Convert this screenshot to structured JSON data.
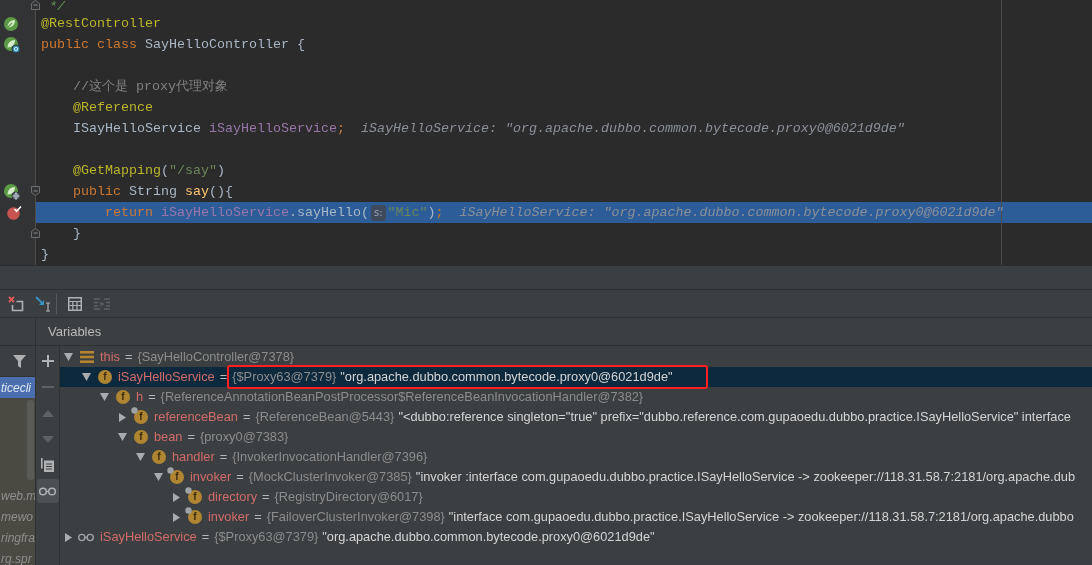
{
  "editor": {
    "lines": [
      {
        "tokens": [
          {
            "text": " */",
            "kind": "doc"
          }
        ],
        "fold_marker": {
          "kind": "end"
        },
        "current": false
      },
      {
        "tokens": [
          {
            "text": "@RestController",
            "kind": "annotation"
          }
        ],
        "gutter_icon": {
          "kind": "leaf"
        },
        "current": false
      },
      {
        "tokens": [
          {
            "text": "public class ",
            "kind": "keyword"
          },
          {
            "text": "SayHelloController {",
            "kind": "plain"
          }
        ],
        "gutter_icon": {
          "kind": "leaf_class"
        },
        "current": false
      },
      {
        "current": false
      },
      {
        "tokens": [
          {
            "text": "    //这个是 proxy代理对象",
            "kind": "comment"
          }
        ],
        "current": false
      },
      {
        "tokens": [
          {
            "text": "    @Reference",
            "kind": "annotation"
          }
        ],
        "current": false
      },
      {
        "tokens": [
          {
            "text": "    ISayHelloService ",
            "kind": "plain"
          },
          {
            "text": "iSayHelloService",
            "kind": "field"
          },
          {
            "text": ";",
            "kind": "keyword"
          }
        ],
        "hint": "iSayHelloService: \"org.apache.dubbo.common.bytecode.proxy0@6021d9de\"",
        "current": false
      },
      {
        "current": false
      },
      {
        "tokens": [
          {
            "text": "    @GetMapping",
            "kind": "annotation"
          },
          {
            "text": "(",
            "kind": "plain"
          },
          {
            "text": "\"/say\"",
            "kind": "string"
          },
          {
            "text": ")",
            "kind": "plain"
          }
        ],
        "current": false
      },
      {
        "tokens": [
          {
            "text": "    public ",
            "kind": "keyword"
          },
          {
            "text": "String ",
            "kind": "plain"
          },
          {
            "text": "say",
            "kind": "method"
          },
          {
            "text": "(){",
            "kind": "plain"
          }
        ],
        "gutter_icon": {
          "kind": "leaf_web"
        },
        "fold_marker": {
          "kind": "start"
        },
        "current": false
      },
      {
        "tokens": [
          {
            "text": "        return ",
            "kind": "keyword"
          },
          {
            "text": "iSayHelloService",
            "kind": "field"
          },
          {
            "text": ".sayHello(",
            "kind": "plain"
          },
          {
            "text": "s:",
            "kind": "param_hint"
          },
          {
            "text": "\"Mic\"",
            "kind": "string"
          },
          {
            "text": ")",
            "kind": "plain"
          },
          {
            "text": ";",
            "kind": "keyword"
          }
        ],
        "gutter_icon": {
          "kind": "breakpoint"
        },
        "hint": "iSayHelloService: \"org.apache.dubbo.common.bytecode.proxy0@6021d9de\"",
        "current": true
      },
      {
        "tokens": [
          {
            "text": "    }",
            "kind": "plain"
          }
        ],
        "fold_marker": {
          "kind": "end"
        },
        "current": false
      },
      {
        "tokens": [
          {
            "text": "}",
            "kind": "plain"
          }
        ],
        "current": false
      }
    ]
  },
  "debugger": {
    "toolbar": [
      {
        "kind": "drop_frame",
        "disabled": false
      },
      {
        "kind": "execution_point",
        "disabled": false
      },
      {
        "kind": "separator"
      },
      {
        "kind": "table",
        "disabled": false
      },
      {
        "kind": "columns",
        "disabled": true
      }
    ],
    "frames": {
      "items": [
        {
          "text": "ticecli",
          "selected": true
        },
        {
          "text": "web.m",
          "selected": false
        },
        {
          "text": "mewo",
          "selected": false
        },
        {
          "text": "ringfra",
          "selected": false
        },
        {
          "text": "rg.spr",
          "selected": false
        }
      ]
    },
    "variables": {
      "title": "Variables",
      "toolbar": [
        {
          "kind": "add",
          "disabled": false,
          "on": false
        },
        {
          "kind": "remove",
          "disabled": true,
          "on": false
        },
        {
          "kind": "up",
          "disabled": true,
          "on": false
        },
        {
          "kind": "down",
          "disabled": true,
          "on": false
        },
        {
          "kind": "copy",
          "disabled": false,
          "on": false
        },
        {
          "kind": "watches",
          "disabled": false,
          "on": true
        }
      ],
      "tree": [
        {
          "kind": "object",
          "name": "this",
          "separator": "=",
          "value": "{SayHelloController@7378}",
          "expanded": true,
          "selected": false,
          "annotated": false,
          "children": [
            {
              "kind": "field",
              "icon_letter": "f",
              "final": false,
              "name": "iSayHelloService",
              "separator": "=",
              "value": "{$Proxy63@7379}",
              "string": "\"org.apache.dubbo.common.bytecode.proxy0@6021d9de\"",
              "expanded": true,
              "selected": true,
              "annotated": true,
              "children": [
                {
                  "kind": "field",
                  "icon_letter": "f",
                  "final": false,
                  "name": "h",
                  "separator": "=",
                  "value": "{ReferenceAnnotationBeanPostProcessor$ReferenceBeanInvocationHandler@7382}",
                  "expanded": true,
                  "selected": false,
                  "annotated": false,
                  "children": [
                    {
                      "kind": "field",
                      "icon_letter": "f",
                      "final": true,
                      "name": "referenceBean",
                      "separator": "=",
                      "value": "{ReferenceBean@5443}",
                      "string": "\"<dubbo:reference singleton=\"true\" prefix=\"dubbo.reference.com.gupaoedu.dubbo.practice.ISayHelloService\" interface",
                      "expanded": false,
                      "selected": false,
                      "annotated": false
                    },
                    {
                      "kind": "field",
                      "icon_letter": "f",
                      "final": false,
                      "name": "bean",
                      "separator": "=",
                      "value": "{proxy0@7383}",
                      "expanded": true,
                      "selected": false,
                      "annotated": false,
                      "children": [
                        {
                          "kind": "field",
                          "icon_letter": "f",
                          "final": false,
                          "name": "handler",
                          "separator": "=",
                          "value": "{InvokerInvocationHandler@7396}",
                          "expanded": true,
                          "selected": false,
                          "annotated": false,
                          "children": [
                            {
                              "kind": "field",
                              "icon_letter": "f",
                              "final": true,
                              "name": "invoker",
                              "separator": "=",
                              "value": "{MockClusterInvoker@7385}",
                              "string": "\"invoker :interface com.gupaoedu.dubbo.practice.ISayHelloService -> zookeeper://118.31.58.7:2181/org.apache.dub",
                              "expanded": true,
                              "selected": false,
                              "annotated": false,
                              "children": [
                                {
                                  "kind": "field",
                                  "icon_letter": "f",
                                  "final": true,
                                  "name": "directory",
                                  "separator": "=",
                                  "value": "{RegistryDirectory@6017}",
                                  "expanded": false,
                                  "selected": false,
                                  "annotated": false
                                },
                                {
                                  "kind": "field",
                                  "icon_letter": "f",
                                  "final": true,
                                  "name": "invoker",
                                  "separator": "=",
                                  "value": "{FailoverClusterInvoker@7398}",
                                  "string": "\"interface com.gupaoedu.dubbo.practice.ISayHelloService -> zookeeper://118.31.58.7:2181/org.apache.dubbo",
                                  "expanded": false,
                                  "selected": false,
                                  "annotated": false
                                }
                              ]
                            }
                          ]
                        }
                      ]
                    }
                  ]
                }
              ]
            }
          ]
        },
        {
          "kind": "watch",
          "name": "iSayHelloService",
          "separator": "=",
          "value": "{$Proxy63@7379}",
          "string": "\"org.apache.dubbo.common.bytecode.proxy0@6021d9de\"",
          "expanded": false,
          "selected": false,
          "annotated": false
        }
      ]
    }
  }
}
